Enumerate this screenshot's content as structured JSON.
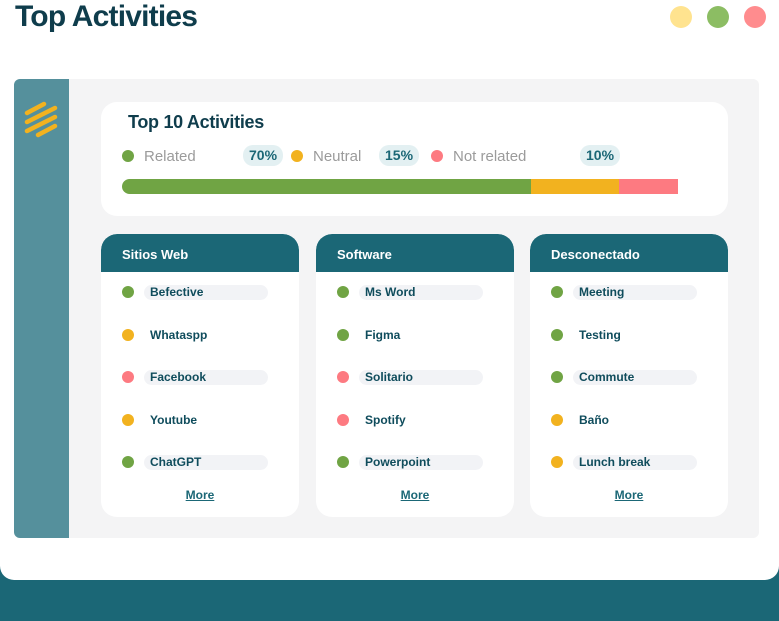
{
  "app": {
    "title": "Top Activities"
  },
  "window_controls": [
    {
      "name": "yellow-dot",
      "color": "#ffe38f"
    },
    {
      "name": "green-dot",
      "color": "#8cbd63"
    },
    {
      "name": "red-dot",
      "color": "#ff8c8e"
    }
  ],
  "colors": {
    "related": "#70a444",
    "neutral": "#f2b21f",
    "not_related": "#fd7a81",
    "header": "#1b6776",
    "sidebar": "#55909c",
    "logo": "#f2b21f"
  },
  "summary": {
    "title": "Top 10 Activities",
    "legend": [
      {
        "label": "Related",
        "percent": "70%",
        "share": 0.7
      },
      {
        "label": "Neutral",
        "percent": "15%",
        "share": 0.15
      },
      {
        "label": "Not related",
        "percent": "10%",
        "share": 0.1
      }
    ]
  },
  "cards": [
    {
      "title": "Sitios Web",
      "more": "More",
      "items": [
        {
          "label": "Befective",
          "status": "related"
        },
        {
          "label": "Whataspp",
          "status": "neutral"
        },
        {
          "label": "Facebook",
          "status": "not_related"
        },
        {
          "label": "Youtube",
          "status": "neutral"
        },
        {
          "label": "ChatGPT",
          "status": "related"
        }
      ]
    },
    {
      "title": "Software",
      "more": "More",
      "items": [
        {
          "label": "Ms Word",
          "status": "related"
        },
        {
          "label": "Figma",
          "status": "related"
        },
        {
          "label": "Solitario",
          "status": "not_related"
        },
        {
          "label": "Spotify",
          "status": "not_related"
        },
        {
          "label": "Powerpoint",
          "status": "related"
        }
      ]
    },
    {
      "title": "Desconectado",
      "more": "More",
      "items": [
        {
          "label": "Meeting",
          "status": "related"
        },
        {
          "label": "Testing",
          "status": "related"
        },
        {
          "label": "Commute",
          "status": "related"
        },
        {
          "label": "Baño",
          "status": "neutral"
        },
        {
          "label": "Lunch break",
          "status": "neutral"
        }
      ]
    }
  ]
}
